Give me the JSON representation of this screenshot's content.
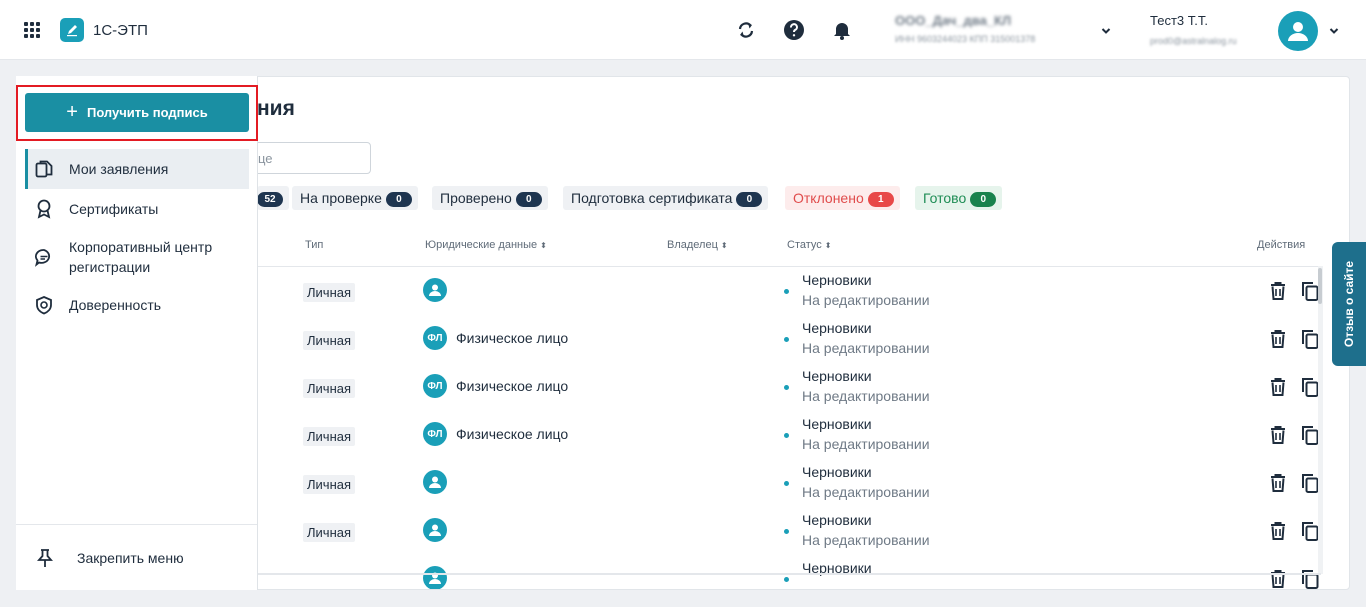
{
  "header": {
    "app_title": "1С-ЭТП",
    "org_name": "ООО_Дач_два_КЛ",
    "org_inn": "ИНН 9603244023 КПП 315001378",
    "user_name": "Тест3 Т.Т.",
    "user_email": "prod0@astralnalog.ru"
  },
  "sidebar": {
    "cta_label": "Получить подпись",
    "items": [
      {
        "label": "Мои заявления",
        "icon": "documents-icon",
        "active": true
      },
      {
        "label": "Сертификаты",
        "icon": "award-icon"
      },
      {
        "label": "Корпоративный центр регистрации",
        "icon": "chat-icon"
      },
      {
        "label": "Доверенность",
        "icon": "shield-icon"
      }
    ],
    "pin_label": "Закрепить меню"
  },
  "main": {
    "title": "ния",
    "search_placeholder": "це",
    "filters": [
      {
        "label": "",
        "count": "52",
        "variant": "default"
      },
      {
        "label": "На проверке",
        "count": "0",
        "variant": "default"
      },
      {
        "label": "Проверено",
        "count": "0",
        "variant": "default"
      },
      {
        "label": "Подготовка сертификата",
        "count": "0",
        "variant": "default"
      },
      {
        "label": "Отклонено",
        "count": "1",
        "variant": "rejected"
      },
      {
        "label": "Готово",
        "count": "0",
        "variant": "done"
      }
    ],
    "columns": {
      "type": "Тип",
      "legal": "Юридические данные",
      "owner": "Владелец",
      "status": "Статус",
      "actions": "Действия"
    },
    "rows": [
      {
        "type": "Личная",
        "legal_icon": "person",
        "legal_text": "",
        "status": "Черновики",
        "substatus": "На редактировании"
      },
      {
        "type": "Личная",
        "legal_icon": "ФЛ",
        "legal_text": "Физическое лицо",
        "status": "Черновики",
        "substatus": "На редактировании"
      },
      {
        "type": "Личная",
        "legal_icon": "ФЛ",
        "legal_text": "Физическое лицо",
        "status": "Черновики",
        "substatus": "На редактировании"
      },
      {
        "type": "Личная",
        "legal_icon": "ФЛ",
        "legal_text": "Физическое лицо",
        "status": "Черновики",
        "substatus": "На редактировании"
      },
      {
        "type": "Личная",
        "legal_icon": "person",
        "legal_text": "",
        "status": "Черновики",
        "substatus": "На редактировании"
      },
      {
        "type": "Личная",
        "legal_icon": "person",
        "legal_text": "",
        "status": "Черновики",
        "substatus": "На редактировании"
      },
      {
        "type": "",
        "legal_icon": "person",
        "legal_text": "",
        "status": "Черновики",
        "substatus": ""
      }
    ]
  },
  "feedback_label": "Отзыв о сайте",
  "colors": {
    "accent": "#1a8fa3",
    "highlight_frame": "#e31b23",
    "rejected": "#e84848",
    "done": "#19824d"
  }
}
